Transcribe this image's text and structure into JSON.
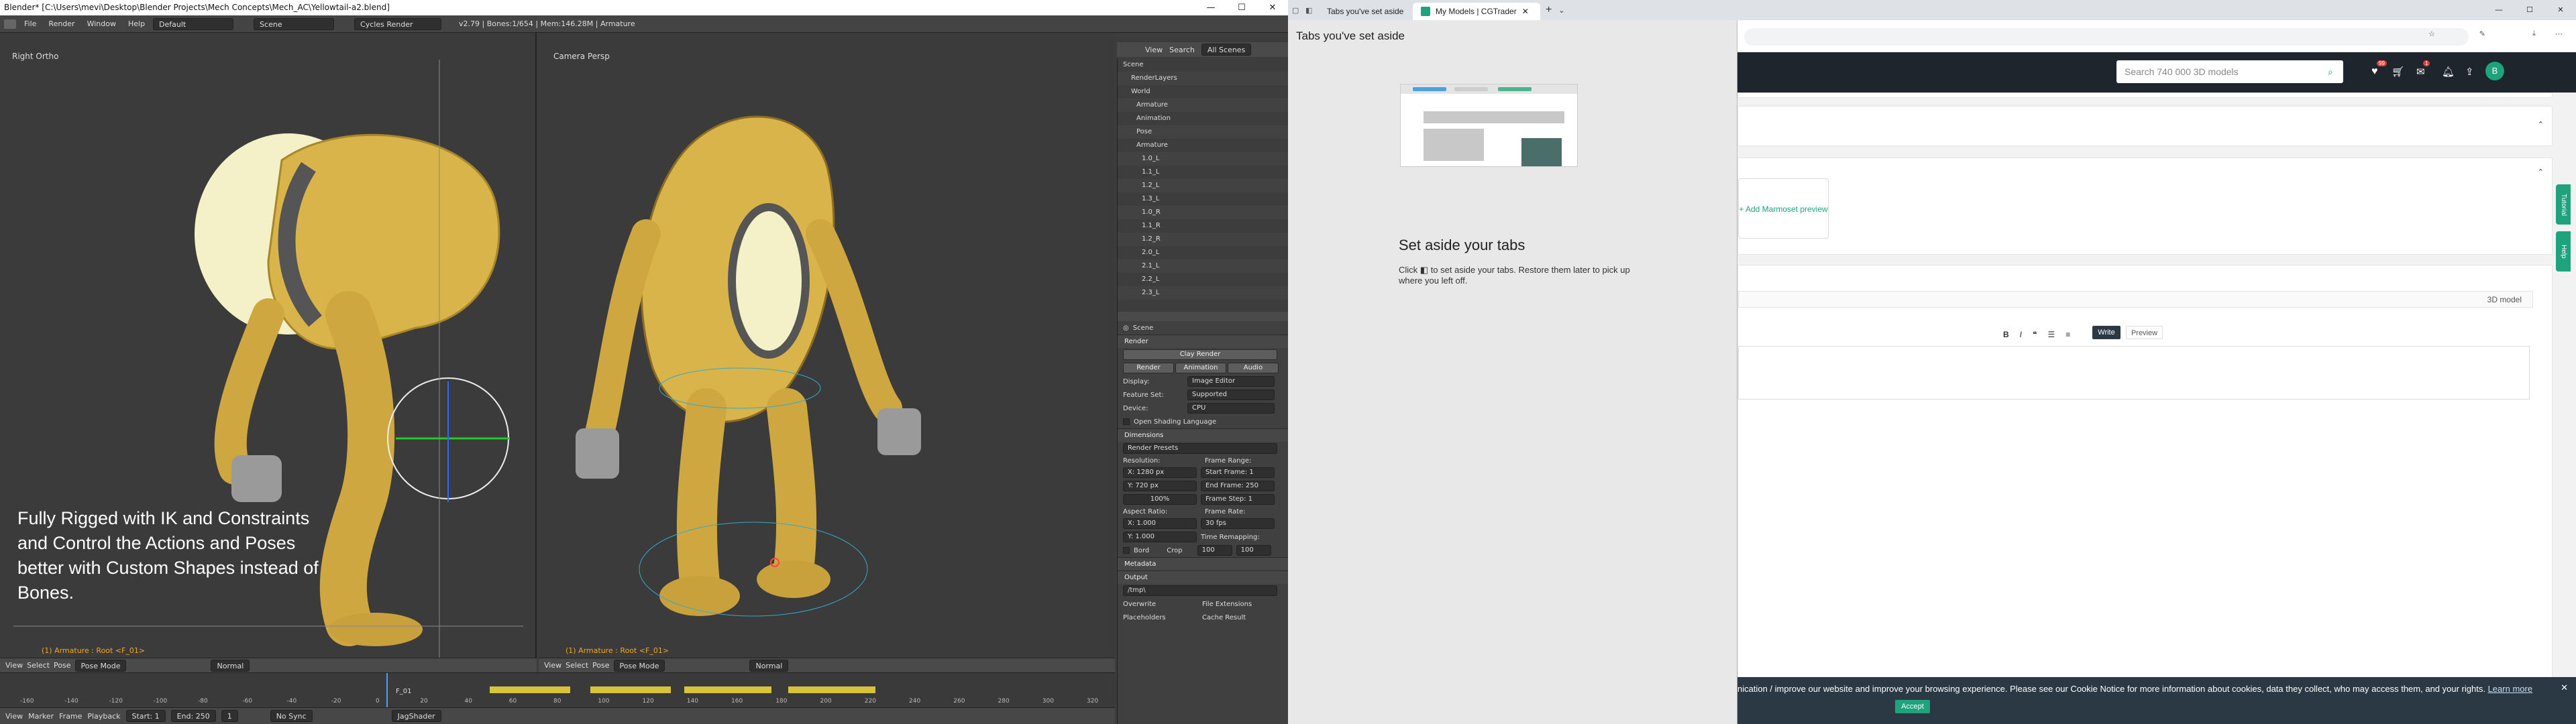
{
  "blender": {
    "title": "Blender* [C:\\Users\\mevi\\Desktop\\Blender Projects\\Mech Concepts\\Mech_AC\\Yellowtail-a2.blend]",
    "window_controls": [
      "—",
      "☐",
      "✕"
    ],
    "menus": [
      "File",
      "Render",
      "Window",
      "Help"
    ],
    "layout": "Default",
    "scene": "Scene",
    "engine": "Cycles Render",
    "stats": "v2.79 | Bones:1/654 | Mem:146.28M | Armature",
    "left_view_label": "Right Ortho",
    "right_view_label": "Camera Persp",
    "overlay_text": "Fully Rigged with IK and Constraints and Control the Actions and Poses better with Custom Shapes instead of Bones.",
    "status_left": "(1) Armature : Root <F_01>",
    "status_right": "(1) Armature : Root <F_01>",
    "vp_header": [
      "View",
      "Select",
      "Pose",
      "Pose Mode",
      "Normal"
    ],
    "vp_header_right": [
      "View",
      "Select",
      "Pose",
      "Pose Mode",
      "Normal"
    ],
    "timeline_ticks": [
      "-160",
      "-140",
      "-120",
      "-100",
      "-80",
      "-60",
      "-40",
      "-20",
      "0",
      "20",
      "40",
      "60",
      "80",
      "100",
      "120",
      "140",
      "160",
      "180",
      "200",
      "220",
      "240",
      "260",
      "280",
      "300",
      "320"
    ],
    "timeline_frame": "F_01",
    "timeline_footer": [
      "View",
      "Marker",
      "Frame",
      "Playback",
      "Start: 1",
      "End: 250",
      "1",
      "No Sync",
      "JagShader"
    ],
    "outliner": {
      "tabs": [
        "View",
        "Search",
        "All Scenes"
      ],
      "rows": [
        "Scene",
        "RenderLayers",
        "World",
        "Armature",
        "Animation",
        "Pose",
        "Armature",
        "1.0_L",
        "1.1_L",
        "1.2_L",
        "1.3_L",
        "1.0_R",
        "1.1_R",
        "1.2_R",
        "2.0_L",
        "2.1_L",
        "2.2_L",
        "2.3_L"
      ]
    },
    "props": {
      "scene": "Scene",
      "render_label": "Render",
      "clay_render": "Clay Render",
      "tabs": [
        "Render",
        "Animation",
        "Audio"
      ],
      "display_label": "Display:",
      "display_value": "Image Editor",
      "feature_label": "Feature Set:",
      "feature_value": "Supported",
      "device_label": "Device:",
      "device_value": "CPU",
      "osl": "Open Shading Language",
      "dimensions": "Dimensions",
      "presets": "Render Presets",
      "resolution": "Resolution:",
      "res_x": "X:  1280 px",
      "res_y": "Y:   720 px",
      "res_pct": "100%",
      "frame_range": "Frame Range:",
      "start": "Start Frame: 1",
      "end": "End Frame: 250",
      "step": "Frame Step: 1",
      "aspect": "Aspect Ratio:",
      "ax": "X:  1.000",
      "ay": "Y:  1.000",
      "frame_rate": "Frame Rate:",
      "fps": "30 fps",
      "time_remap": "Time Remapping:",
      "old": "100",
      "new": "100",
      "border": "Bord",
      "crop": "Crop",
      "metadata": "Metadata",
      "output": "Output",
      "output_path": "/tmp\\",
      "overwrite": "Overwrite",
      "file_ext": "File Extensions",
      "placeholders": "Placeholders",
      "cache": "Cache Result"
    }
  },
  "chrome": {
    "tab1": "Tabs you've set aside",
    "tab2": "My Models | CGTrader",
    "window_controls": [
      "—",
      "☐",
      "✕"
    ],
    "aside_title": "Tabs you've set aside",
    "aside_heading": "Set aside your tabs",
    "aside_body_1": "Click",
    "aside_body_2": "to set aside your tabs. Restore them later to pick up where you left off.",
    "search_placeholder": "Search 740 000 3D models",
    "avatar": "B",
    "badges": {
      "heart": "99",
      "mail": "1"
    },
    "marmoset": "+ Add Marmoset preview",
    "model_type": "3D model",
    "write": "Write",
    "preview": "Preview",
    "side_tutorial": "Tutorial",
    "side_help": "Help",
    "cookie_text": "nication / improve our website and improve your browsing experience. Please see our Cookie Notice for more information about cookies, data they collect, who may access them, and your rights.",
    "cookie_link": "Learn more",
    "accept": "Accept",
    "colors": {
      "cg_header": "#1e252c",
      "accent": "#1ea37d",
      "badge": "#e03a3a"
    }
  }
}
